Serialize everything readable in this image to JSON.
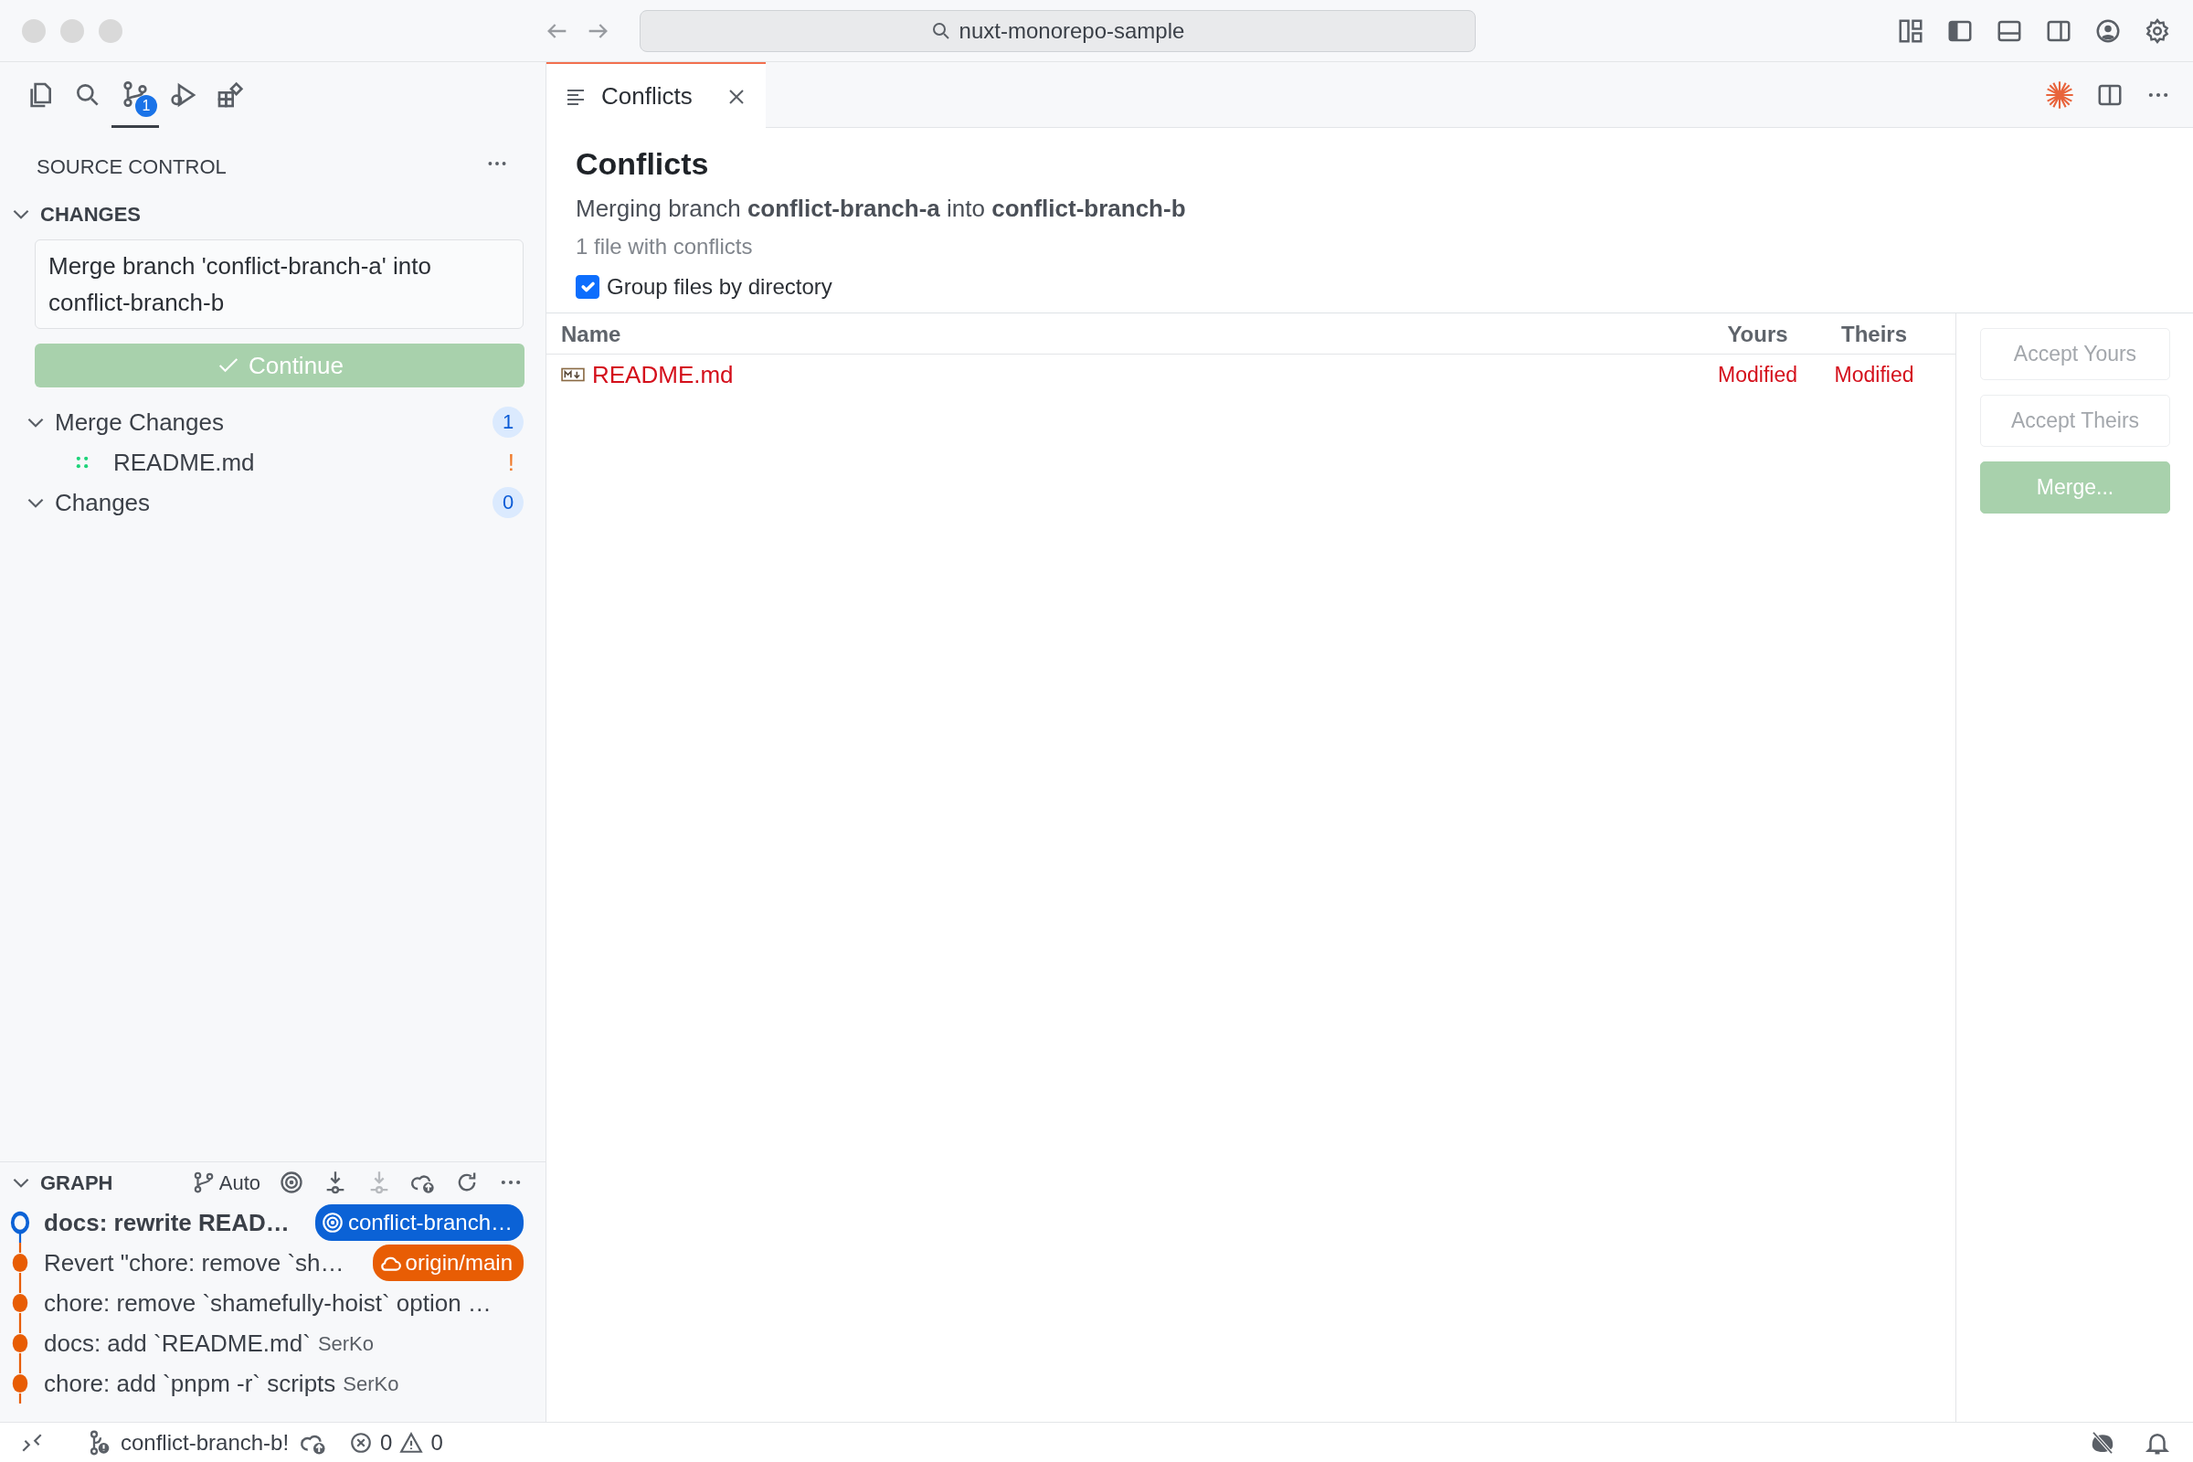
{
  "window": {
    "search": "nuxt-monorepo-sample"
  },
  "activity_bar": {
    "items": [
      {
        "selected": false
      },
      {
        "selected": false
      },
      {
        "selected": true,
        "badge": "1"
      },
      {
        "selected": false
      },
      {
        "selected": false
      }
    ]
  },
  "sidebar": {
    "title": "SOURCE CONTROL",
    "section": {
      "title": "CHANGES",
      "expanded": true
    },
    "commit_message": "Merge branch 'conflict-branch-a' into conflict-branch-b",
    "continue_button": "Continue",
    "groups": [
      {
        "label": "Merge Changes",
        "count": "1",
        "expanded": true,
        "files": [
          {
            "name": "README.md",
            "status": "!"
          }
        ]
      },
      {
        "label": "Changes",
        "count": "0",
        "expanded": true
      }
    ]
  },
  "graph": {
    "title": "GRAPH",
    "expanded": true,
    "mode": "Auto",
    "commits": [
      {
        "message": "docs: rewrite READ…",
        "current": true,
        "ref": {
          "label": "conflict-branch…",
          "kind": "local"
        }
      },
      {
        "message": "Revert \"chore: remove `sh…",
        "current": false,
        "ref": {
          "label": "origin/main",
          "kind": "remote"
        }
      },
      {
        "message": "chore: remove `shamefully-hoist` option …",
        "current": false
      },
      {
        "message": "docs: add `README.md`",
        "current": false,
        "author": "SerKo"
      },
      {
        "message": "chore: add `pnpm -r` scripts",
        "current": false,
        "author": "SerKo"
      }
    ]
  },
  "editor": {
    "tabs": [
      {
        "label": "Conflicts",
        "selected": true
      }
    ],
    "title": "Conflicts",
    "subtitle": "Merging branch **conflict-branch-a** into **conflict-branch-b**",
    "summary": "1 file with conflicts",
    "group_by_directory": {
      "label": "Group files by directory",
      "checked": true
    },
    "table": {
      "columns": [
        "Name",
        "Yours",
        "Theirs"
      ],
      "rows": [
        {
          "name": "README.md",
          "yours": "Modified",
          "theirs": "Modified"
        }
      ]
    },
    "actions": [
      {
        "label": "Accept Yours",
        "kind": "outline",
        "disabled": true
      },
      {
        "label": "Accept Theirs",
        "kind": "outline",
        "disabled": true
      },
      {
        "label": "Merge...",
        "kind": "primary",
        "disabled": true
      }
    ]
  },
  "status_bar": {
    "branch": "conflict-branch-b!",
    "errors": "0",
    "warnings": "0"
  }
}
